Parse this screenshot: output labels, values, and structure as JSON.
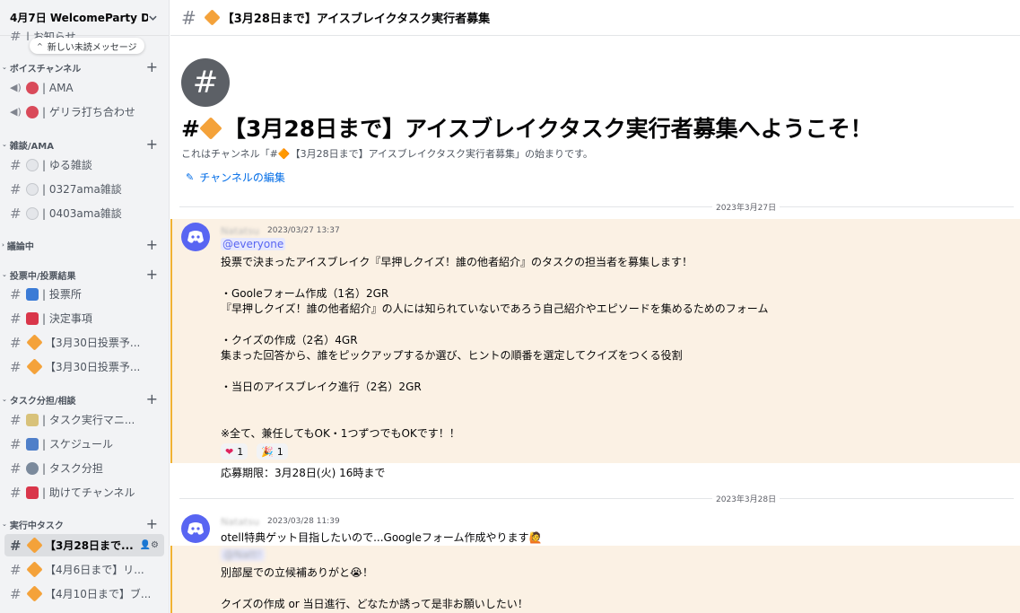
{
  "server": {
    "name": "4月7日 WelcomeParty D..."
  },
  "sidebar": {
    "partial_channel": "| お知らせ",
    "new_unread": "新しい未読メッセージ",
    "categories": [
      {
        "label": "ボイスチャンネル",
        "channels": [
          {
            "label": "| AMA"
          },
          {
            "label": "| ゲリラ打ち合わせ"
          }
        ]
      },
      {
        "label": "雑談/AMA",
        "channels": [
          {
            "label": "| ゆる雑談"
          },
          {
            "label": "| 0327ama雑談"
          },
          {
            "label": "| 0403ama雑談"
          }
        ]
      },
      {
        "label": "議論中",
        "channels": []
      },
      {
        "label": "投票中/投票結果",
        "channels": [
          {
            "label": "| 投票所"
          },
          {
            "label": "| 決定事項"
          },
          {
            "label": "【3月30日投票予..."
          },
          {
            "label": "【3月30日投票予..."
          }
        ]
      },
      {
        "label": "タスク分担/相談",
        "channels": [
          {
            "label": "| タスク実行マニ..."
          },
          {
            "label": "| スケジュール"
          },
          {
            "label": "| タスク分担"
          },
          {
            "label": "| 助けてチャンネル"
          }
        ]
      },
      {
        "label": "実行中タスク",
        "channels": [
          {
            "label": "【3月28日まで..."
          },
          {
            "label": "【4月6日まで】リ..."
          },
          {
            "label": "【4月10日まで】ブ..."
          }
        ]
      }
    ]
  },
  "channel": {
    "title": "【3月28日まで】アイスブレイクタスク実行者募集",
    "welcome_title": "【3月28日まで】アイスブレイクタスク実行者募集へようこそ！",
    "welcome_sub": "これはチャンネル「#🔶【3月28日まで】アイスブレイクタスク実行者募集」の始まりです。",
    "edit_label": "チャンネルの編集"
  },
  "messages": {
    "date1": "2023年3月27日",
    "m1": {
      "author": "Natatsu",
      "time": "2023/03/27 13:37",
      "mention": "@everyone",
      "lines": [
        "投票で決まったアイスブレイク『早押しクイズ！誰の他者紹介』のタスクの担当者を募集します！",
        "・Gooleフォーム作成（1名）2GR",
        "『早押しクイズ！誰の他者紹介』の人には知られていないであろう自己紹介やエピソードを集めるためのフォーム",
        "・クイズの作成（2名）4GR",
        "集まった回答から、誰をピックアップするか選び、ヒントの順番を選定してクイズをつくる役割",
        "・当日のアイスブレイク進行（2名）2GR",
        "※全て、兼任してもOK・1つずつでもOKです！！",
        "応募期限：3月28日(火) 16時まで"
      ],
      "reactions": [
        {
          "emoji": "❤",
          "count": "1"
        },
        {
          "emoji": "🎉",
          "count": "1"
        }
      ]
    },
    "date2": "2023年3月28日",
    "m2": {
      "author": "Natatsu",
      "time": "2023/03/28 11:39",
      "lines": [
        "otell特典ゲット目指したいので...Googleフォーム作成やります🙋"
      ]
    },
    "m3": {
      "mention": "@Natt!",
      "lines": [
        "別部屋での立候補ありがと😭！",
        "クイズの作成 or 当日進行、どなたか誘って是非お願いしたい！"
      ]
    }
  },
  "colors": {
    "accent": "#5865f2",
    "highlight_bg": "#fbf1e4",
    "highlight_bar": "#f0b232",
    "link": "#006ce7"
  }
}
